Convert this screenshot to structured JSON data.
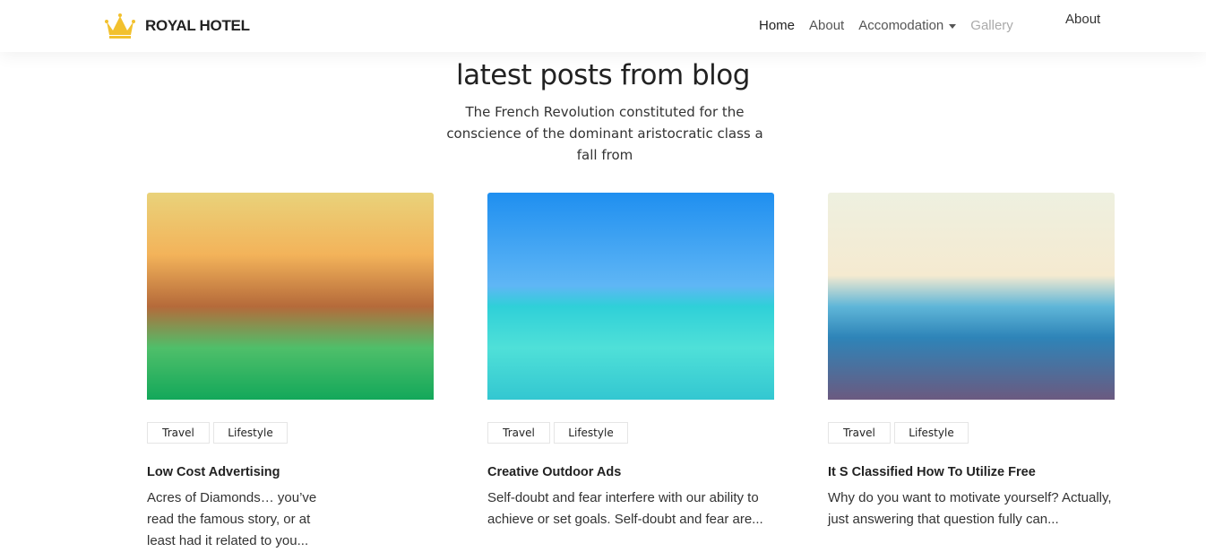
{
  "brand": {
    "name": "ROYAL HOTEL"
  },
  "nav": {
    "items": [
      "Home",
      "About",
      "Accomodation",
      "Gallery"
    ],
    "extra": "About"
  },
  "section": {
    "title": "latest posts from blog",
    "subtitle": "The French Revolution constituted for the conscience of the dominant aristocratic class a fall from"
  },
  "posts": [
    {
      "tags": [
        "Travel",
        "Lifestyle"
      ],
      "title": "Low Cost Advertising",
      "desc": "Acres of Diamonds… you’ve read the famous story, or at least had it related to you..."
    },
    {
      "tags": [
        "Travel",
        "Lifestyle"
      ],
      "title": "Creative Outdoor Ads",
      "desc": "Self-doubt and fear interfere with our ability to achieve or set goals. Self-doubt and fear are..."
    },
    {
      "tags": [
        "Travel",
        "Lifestyle"
      ],
      "title": "It S Classified How To Utilize Free",
      "desc": "Why do you want to motivate yourself? Actually, just answering that question fully can..."
    }
  ]
}
